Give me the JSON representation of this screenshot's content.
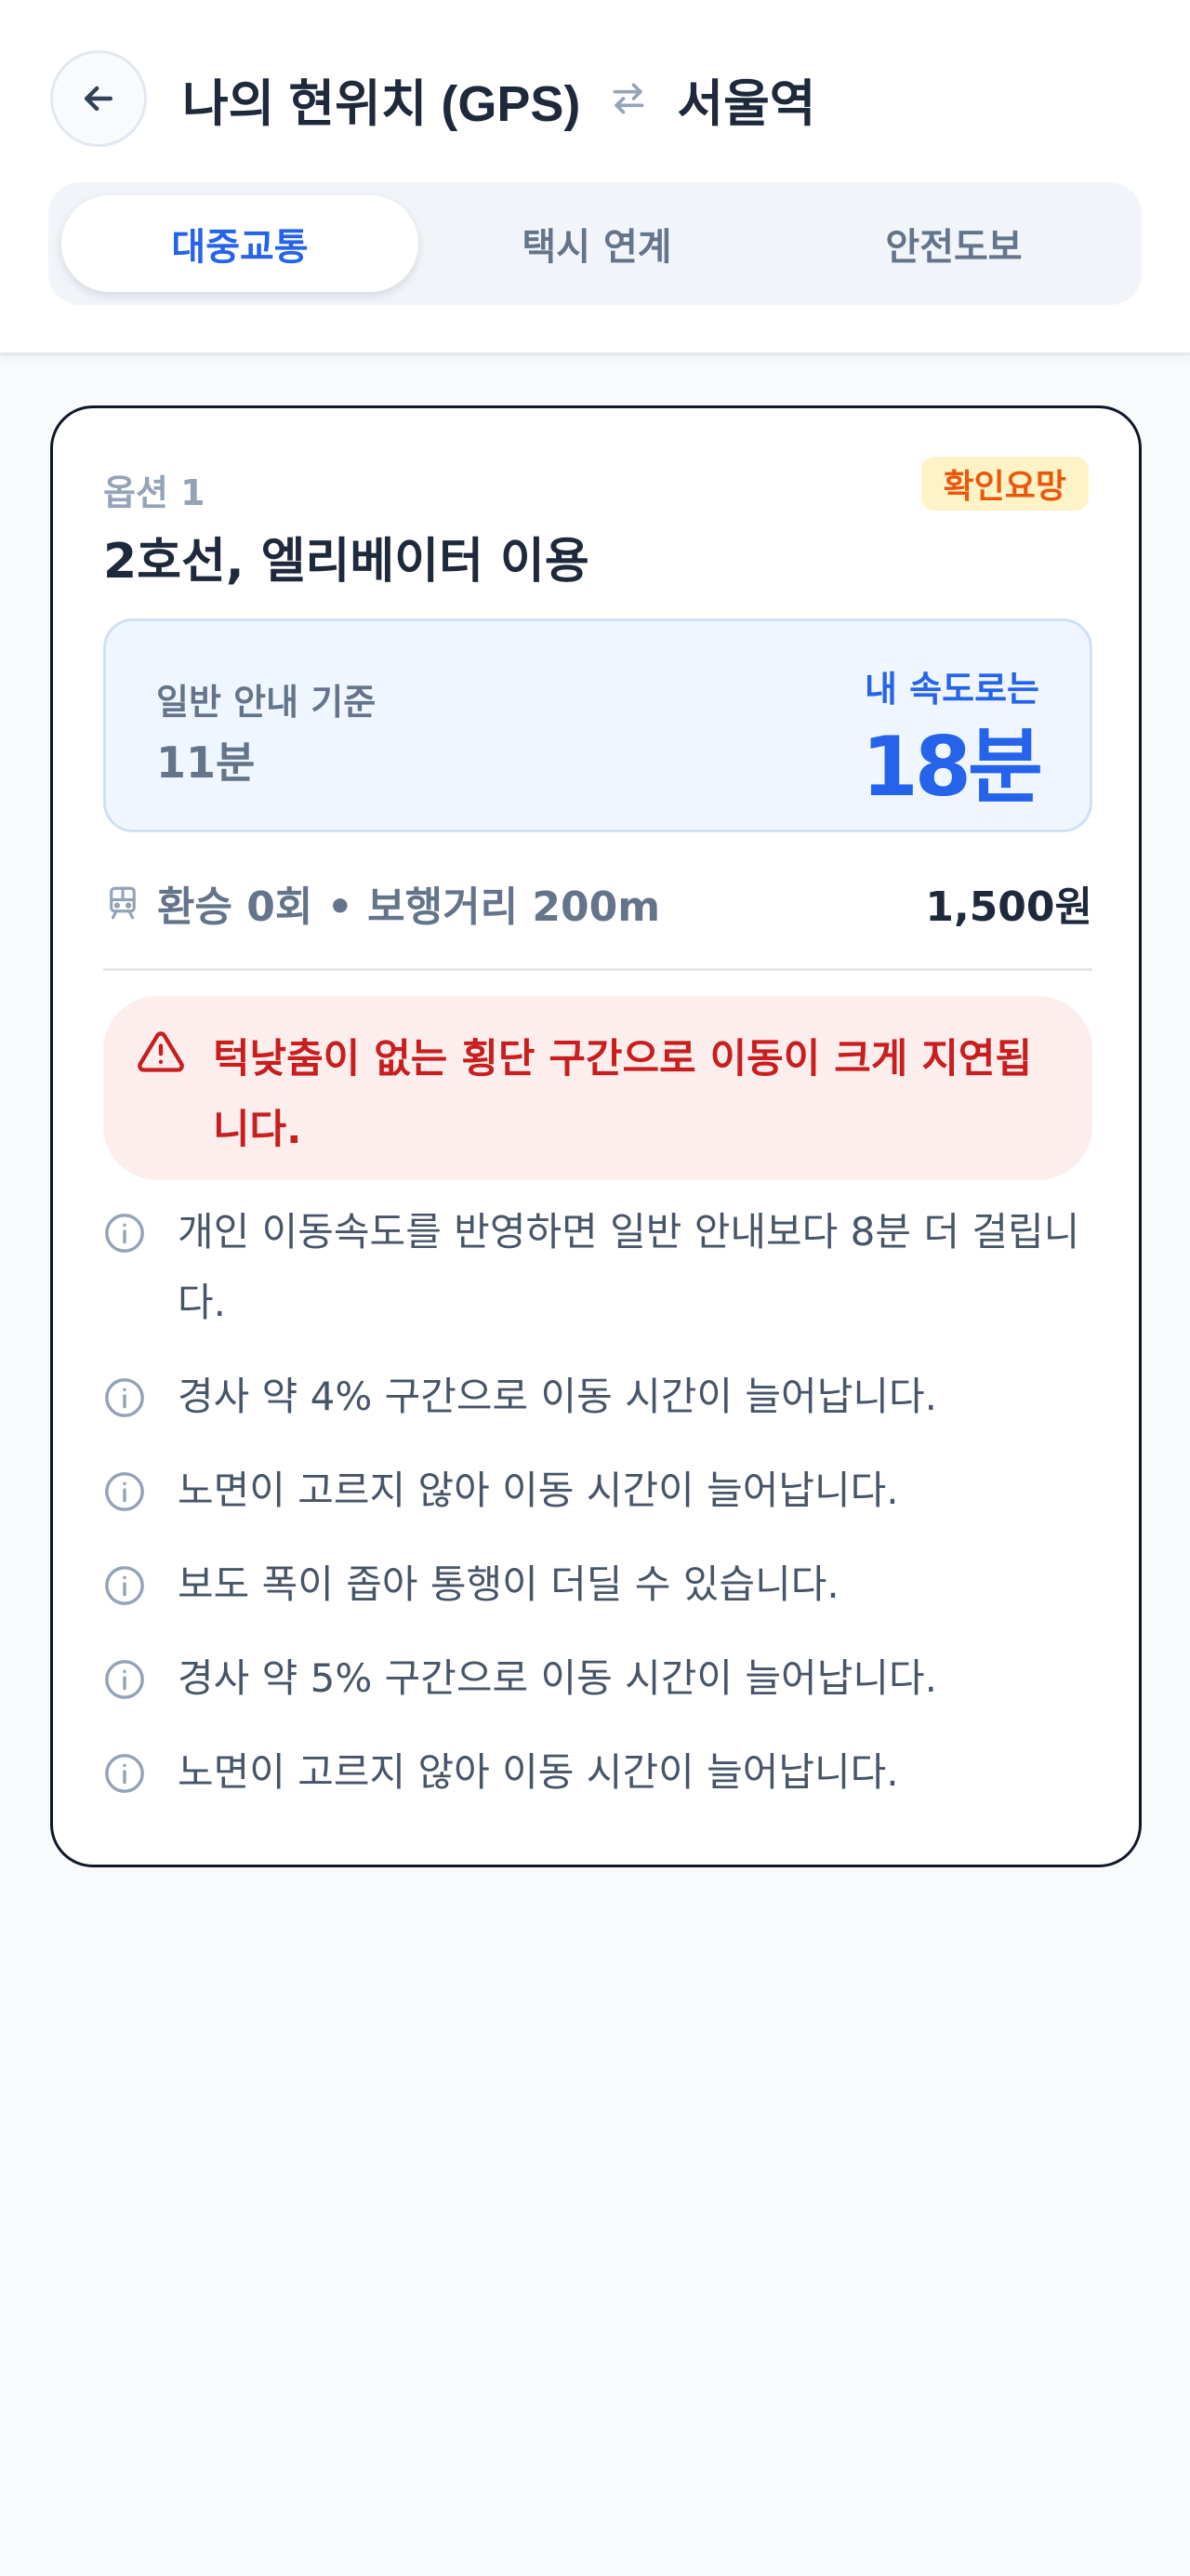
{
  "header": {
    "origin": "나의 현위치 (GPS)",
    "destination": "서울역",
    "back_icon": "arrow-left-icon",
    "swap_icon": "swap-arrows-icon"
  },
  "tabs": [
    {
      "label": "대중교통",
      "active": true
    },
    {
      "label": "택시 연계",
      "active": false
    },
    {
      "label": "안전도보",
      "active": false
    }
  ],
  "route": {
    "option_label": "옵션 1",
    "badge": "확인요망",
    "title": "2호선, 엘리베이터 이용",
    "normal_label": "일반 안내 기준",
    "normal_time": "11분",
    "speed_label": "내 속도로는",
    "speed_time": "18분",
    "meta_icon": "train-icon",
    "meta": "환승 0회 • 보행거리 200m",
    "fare": "1,500원",
    "alert_icon": "warning-triangle-icon",
    "alert": "턱낮춤이 없는 횡단 구간으로 이동이 크게 지연됩니다.",
    "notes": [
      "개인 이동속도를 반영하면 일반 안내보다 8분 더 걸립니다.",
      "경사 약 4% 구간으로 이동 시간이 늘어납니다.",
      "노면이 고르지 않아 이동 시간이 늘어납니다.",
      "보도 폭이 좁아 통행이 더딜 수 있습니다.",
      "경사 약 5% 구간으로 이동 시간이 늘어납니다.",
      "노면이 고르지 않아 이동 시간이 늘어납니다."
    ],
    "note_icon": "info-circle-icon"
  },
  "colors": {
    "accent": "#2563eb",
    "badge_bg": "#fef3c7",
    "badge_text": "#ea580c",
    "alert_bg": "#fdeeee",
    "alert_text": "#c81e1e"
  }
}
